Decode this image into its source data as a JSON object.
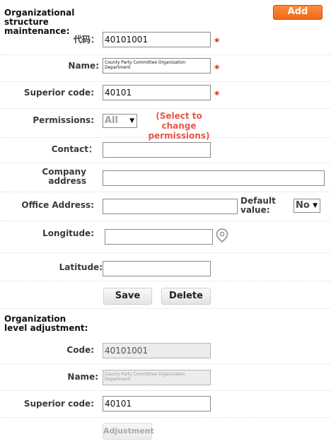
{
  "org_maintenance": {
    "title": "Organizational structure maintenance:",
    "add_label": "Add",
    "code": {
      "label": "代码：",
      "value": "40101001"
    },
    "name": {
      "label": "Name:",
      "value": "County Party Committee Organization Department"
    },
    "superior_code": {
      "label": "Superior code:",
      "value": "40101"
    },
    "permissions": {
      "label": "Permissions:",
      "selected": "All",
      "hint": "(Select to change permissions)"
    },
    "contact": {
      "label": "Contact：",
      "value": ""
    },
    "company_address": {
      "label": "Company address",
      "value": ""
    },
    "office_address": {
      "label": "Office Address:",
      "value": ""
    },
    "default_value": {
      "label": "Default value:",
      "selected": "No"
    },
    "longitude": {
      "label": "Longitude:",
      "value": ""
    },
    "latitude": {
      "label": "Latitude:",
      "value": ""
    },
    "save_label": "Save",
    "delete_label": "Delete",
    "required_mark": "*"
  },
  "level_adjustment": {
    "title": "Organization level adjustment:",
    "code": {
      "label": "Code:",
      "value": "40101001"
    },
    "name": {
      "label": "Name:",
      "value": "County Party Committee Organization Department"
    },
    "superior_code": {
      "label": "Superior code:",
      "value": "40101"
    },
    "adjust_label": "Adjustment"
  },
  "icons": {
    "location": "location-pin-icon",
    "dropdown": "dropdown-arrow-icon"
  },
  "colors": {
    "required": "#d02a1e",
    "hint": "#e8564a",
    "add_button": "#f47a2a"
  }
}
